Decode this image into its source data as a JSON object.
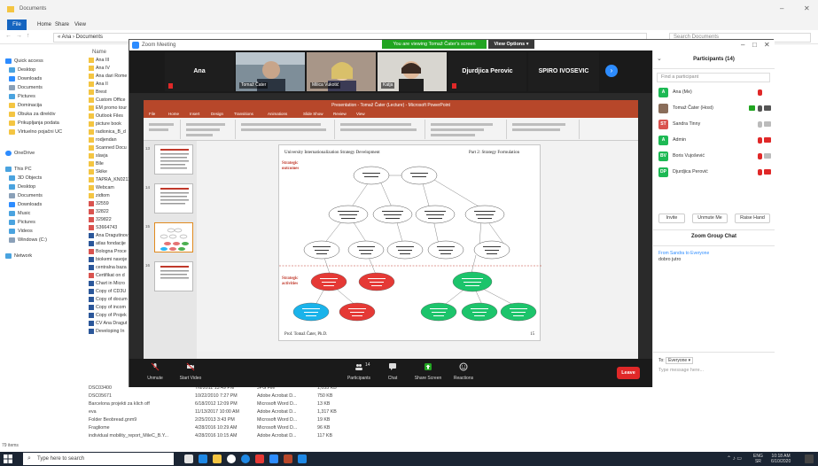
{
  "explorer": {
    "title": "Documents",
    "ribbon_tabs": [
      "File",
      "Home",
      "Share",
      "View"
    ],
    "address": "« Ana › Documents",
    "search_placeholder": "Search Documents",
    "column_name": "Name",
    "nav_items": [
      "Quick access",
      "Desktop",
      "Downloads",
      "Documents",
      "Pictures",
      "Dominacija",
      "Obuka za direktiv",
      "Prikupljanja podata",
      "Virtuelno pojačni UC",
      "OneDrive",
      "This PC",
      "3D Objects",
      "Desktop",
      "Documents",
      "Downloads",
      "Music",
      "Pictures",
      "Videos",
      "Windows (C:)",
      "Network"
    ],
    "list_items": [
      "Ana III",
      "Ana IV",
      "Ana dari Rome",
      "Ana II",
      "Brest",
      "Custom Office",
      "EM promo tour",
      "Outlook Files",
      "picture book",
      "radionica_B_d",
      "rodjendan",
      "Scanned Docu",
      "slavja",
      "Blle",
      "Skike",
      "TAPRA_KN0211",
      "Webcam",
      "zidtom",
      "32559",
      "32822",
      "329822",
      "S3664743",
      "Ana Dragutinov",
      "atlas fondacije",
      "Bologna Proce",
      "biokemi navoje",
      "centralna baza",
      "Certifikat on d",
      "Chart in Micro",
      "Copy of CD3U",
      "Copy of docum",
      "Copy of incom",
      "Copy of Projek",
      "CV Ana Dragut",
      "Developing In"
    ],
    "bottom_rows": [
      {
        "name": "DSC03400",
        "date": "7/6/2011 13:49 PM",
        "type": "JPG File",
        "size": "1,055 KB"
      },
      {
        "name": "DSC05671",
        "date": "10/22/2010 7:27 PM",
        "type": "Adobe Acrobat D...",
        "size": "750 KB"
      },
      {
        "name": "Barcelona projekti za klich off",
        "date": "6/18/2012 12:09 PM",
        "type": "Microsoft Word D...",
        "size": "13 KB"
      },
      {
        "name": "eva",
        "date": "11/13/2017 10:00 AM",
        "type": "Adobe Acrobat D...",
        "size": "1,317 KB"
      },
      {
        "name": "Folder Beobread.gnm9",
        "date": "2/25/2013 3:43 PM",
        "type": "Microsoft Word D...",
        "size": "19 KB"
      },
      {
        "name": "Fragliome",
        "date": "4/28/2016 10:29 AM",
        "type": "Microsoft Word D...",
        "size": "96 KB"
      },
      {
        "name": "individual mobility_report_MileC_B.Y...",
        "date": "4/28/2016 10:15 AM",
        "type": "Adobe Acrobat D...",
        "size": "117 KB"
      }
    ],
    "status": "79 items"
  },
  "zoom": {
    "window_title": "Zoom Meeting",
    "viewing_banner": "You are viewing Tomaž Čater's screen",
    "view_options": "View Options ▾",
    "participants_strip": [
      {
        "name": "Ana",
        "video": false
      },
      {
        "name": "Tomaž Čater",
        "video": true
      },
      {
        "name": "Milica Vukotić",
        "video": true
      },
      {
        "name": "Katja",
        "video": true
      },
      {
        "name": "Djurdjica Perovic",
        "video": false
      },
      {
        "name": "SPIRO IVOSEVIC",
        "video": false
      }
    ],
    "toolbar": {
      "unmute": "Unmute",
      "start_video": "Start Video",
      "participants": "Participants",
      "participants_count": "14",
      "chat": "Chat",
      "share_screen": "Share Screen",
      "reactions": "Reactions",
      "leave": "Leave"
    },
    "panel": {
      "title": "Participants (14)",
      "find_placeholder": "Find a participant",
      "participants": [
        {
          "initials": "A",
          "name": "Ana (Me)",
          "color": "#1db954"
        },
        {
          "initials": "",
          "name": "Tomaž Čater (Host)",
          "color": "#8a6d5a"
        },
        {
          "initials": "ST",
          "name": "Sandra Tinny",
          "color": "#d9534f"
        },
        {
          "initials": "A",
          "name": "Admin",
          "color": "#1db954"
        },
        {
          "initials": "BV",
          "name": "Boris Vujošević",
          "color": "#1db954"
        },
        {
          "initials": "DP",
          "name": "Djurdjica Perović",
          "color": "#1db954"
        }
      ],
      "invite": "Invite",
      "unmute_me": "Unmute Me",
      "raise_hand": "Raise Hand",
      "chat_title": "Zoom Group Chat",
      "chat_from": "From Sandra to Everyone",
      "chat_message": "dobro jutro",
      "to_label": "To:",
      "to_value": "Everyone ▾",
      "message_placeholder": "Type message here..."
    },
    "ppt": {
      "window_title": "Presentation - Tomaž Čater (Lecture) - Microsoft PowerPoint",
      "tabs": [
        "File",
        "Home",
        "Insert",
        "Design",
        "Transitions",
        "Animations",
        "Slide Show",
        "Review",
        "View"
      ],
      "slide": {
        "title": "University Internationalization Strategy Development",
        "part": "Part 2: Strategy Formulation",
        "side_label_1": "Strategic outcomes",
        "side_label_2": "Strategic activities",
        "author": "Prof. Tomaž Čater, Ph.D.",
        "page": "15",
        "nodes_top": [
          "Long-term financial viability",
          "Long-term reputation"
        ],
        "nodes_mid": [
          "4% increase in revenues from teaching programs",
          "8% increase in demand for our teaching programs",
          "6% increase in revenues from research projects",
          "Researchers are motivated to improve their expertise"
        ],
        "nodes_mid2": [
          "Companies rely on us to transfer consulting work",
          "Students better employable after their graduation",
          "Students able to solve complex practical problems",
          "Researchers possess superior skills and capabilities",
          "Lecturers maintain high pedagogical standards"
        ],
        "nodes_red": [
          "Carry out programs with the state-of-the-art knowledge",
          "Ensure closer cooperation for students with businesses",
          "Raise our reputation in the business community"
        ],
        "nodes_green": [
          "Disseminate knowledge via methodological courses"
        ],
        "nodes_bottom": [
          "Strengthen the image among local business community",
          "Work with employers to define learner outcome profiles",
          "Strengthen methodological training of researchers",
          "Develop research centres to foster research achievements",
          "Make use quality teaching available in the institution"
        ]
      }
    }
  },
  "taskbar": {
    "search_placeholder": "Type here to search",
    "lang": "ENG",
    "lang2": "SR",
    "time": "10:18 AM",
    "date": "6/10/2020"
  }
}
